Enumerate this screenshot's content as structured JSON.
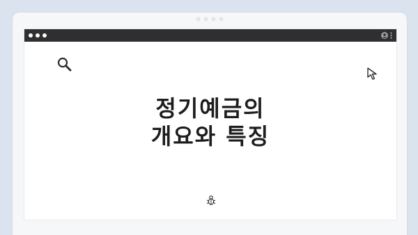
{
  "window": {
    "title_lines": [
      "정기예금의",
      "개요와 특징"
    ]
  },
  "icons": {
    "search": "search-icon",
    "cursor": "cursor-arrow-icon",
    "bug": "bug-icon",
    "profile": "profile-icon",
    "menu": "kebab-menu-icon"
  },
  "colors": {
    "background": "#dbe4ee",
    "titlebar": "#2f2f31",
    "text": "#1d1d1d"
  }
}
